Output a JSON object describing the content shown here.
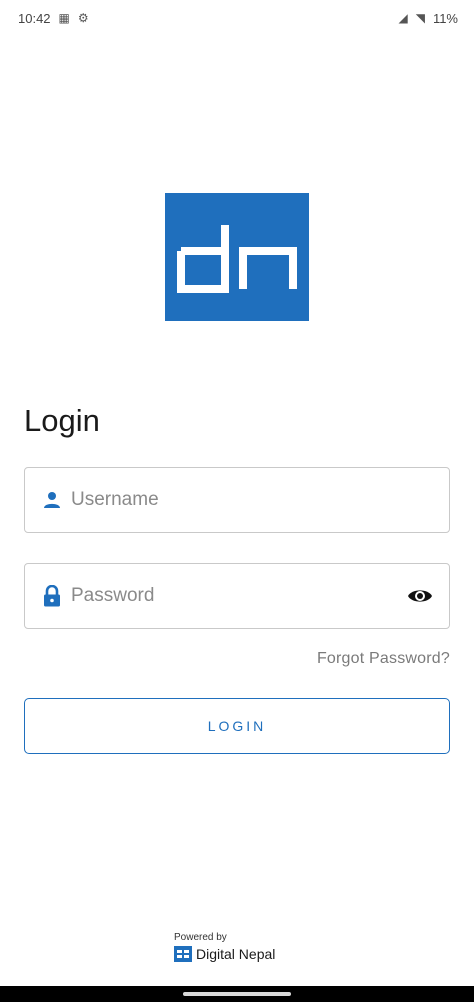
{
  "status_bar": {
    "time": "10:42",
    "battery": "11%"
  },
  "icons": {
    "username": "person-icon",
    "password": "lock-icon",
    "visibility": "eye-icon"
  },
  "colors": {
    "brand": "#1f6fbd"
  },
  "login": {
    "title": "Login",
    "username_placeholder": "Username",
    "password_placeholder": "Password",
    "forgot_label": "Forgot Password?",
    "button_label": "LOGIN"
  },
  "footer": {
    "powered_by": "Powered by",
    "brand": "Digital Nepal"
  }
}
